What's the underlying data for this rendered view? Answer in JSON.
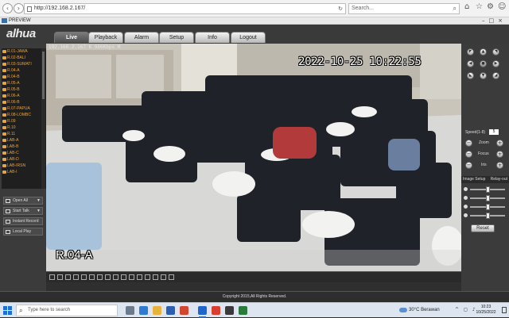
{
  "browser": {
    "url": "http://192.168.2.167/",
    "search_placeholder": "Search...",
    "tab_label": "PREVIEW"
  },
  "app": {
    "logo": "alhua",
    "nav_tabs": [
      "Live",
      "Playback",
      "Alarm",
      "Setup",
      "Info",
      "Logout"
    ],
    "active_tab": "Live"
  },
  "channels": [
    {
      "label": "R.01-JAWA",
      "mark": "M"
    },
    {
      "label": "R.02-BALI",
      "mark": "M"
    },
    {
      "label": "R.03-SUMATI",
      "mark": "M"
    },
    {
      "label": "R.04-A",
      "mark": "M"
    },
    {
      "label": "R.04-B",
      "mark": ""
    },
    {
      "label": "R.05-A",
      "mark": ""
    },
    {
      "label": "R.05-B",
      "mark": ""
    },
    {
      "label": "R.06-A",
      "mark": ""
    },
    {
      "label": "R.06-B",
      "mark": "M"
    },
    {
      "label": "R.07-PAPUA",
      "mark": "M"
    },
    {
      "label": "R.08-LOMBC",
      "mark": ""
    },
    {
      "label": "R.09",
      "mark": ""
    },
    {
      "label": "R.10",
      "mark": "M"
    },
    {
      "label": "R.11",
      "mark": ""
    },
    {
      "label": "LAB-A",
      "mark": "M"
    },
    {
      "label": "LAB-B",
      "mark": "M"
    },
    {
      "label": "LAB-C",
      "mark": "M"
    },
    {
      "label": "LAB-D",
      "mark": ""
    },
    {
      "label": "LAB-IRSN",
      "mark": ""
    },
    {
      "label": "LAB-I",
      "mark": ""
    }
  ],
  "controls": {
    "open_all": "Open All",
    "start_talk": "Start Talk",
    "instant_record": "Instant Record",
    "local_play": "Local Play"
  },
  "video": {
    "stream_info": "192.168.2.167 K 986Kbps M",
    "timestamp": "2022-10-25 10:22:55",
    "room_label": "R.04-A"
  },
  "ptz": {
    "speed_label": "Speed(1-8)",
    "speed_value": "5",
    "zoom_label": "Zoom",
    "focus_label": "Focus",
    "iris_label": "Iris"
  },
  "image_setup": {
    "title": "Image Setup",
    "relay_label": "Relay-out",
    "sliders": [
      0.5,
      0.5,
      0.5,
      0.5
    ],
    "reset_label": "Reset"
  },
  "footer": {
    "text": "Copyright 2015,All Rights Reserved."
  },
  "taskbar": {
    "search_placeholder": "Type here to search",
    "weather_temp": "30°C",
    "weather_desc": "Berawan",
    "clock_time": "10:23",
    "clock_date": "10/25/2022"
  },
  "colors": {
    "channel_text": "#e8a33a",
    "accent": "#1f6fd1"
  }
}
